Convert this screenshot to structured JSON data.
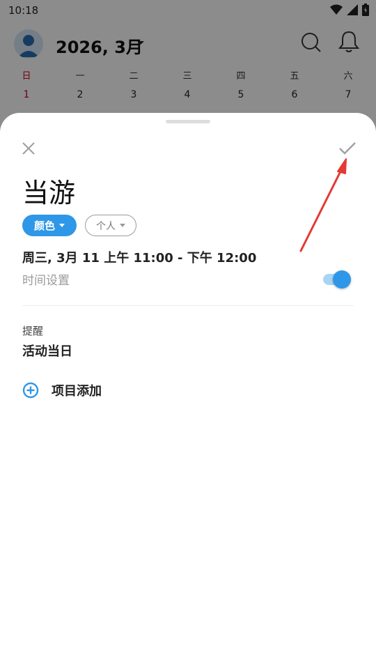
{
  "status_bar": {
    "time": "10:18"
  },
  "calendar": {
    "month_title": "2026, 3月",
    "weekdays": [
      "日",
      "一",
      "二",
      "三",
      "四",
      "五",
      "六"
    ],
    "days": [
      "1",
      "2",
      "3",
      "4",
      "5",
      "6",
      "7"
    ]
  },
  "sheet": {
    "title": "当游",
    "chip_color_label": "颜色",
    "chip_calendar_label": "个人",
    "date_time": "周三, 3月 11 上午 11:00 - 下午 12:00",
    "time_setting_label": "时间设置",
    "time_setting_enabled": true,
    "reminder_label": "提醒",
    "reminder_value": "活动当日",
    "add_item_label": "项目添加"
  },
  "colors": {
    "accent": "#2f97e8",
    "toggle_track": "#a9d5f5",
    "sunday_red": "#d0021b",
    "annotation_red": "#e53935"
  },
  "icons": {
    "close": "close-icon",
    "confirm": "check-icon",
    "add": "plus-circle-icon",
    "search": "search-icon",
    "bell": "bell-icon"
  }
}
